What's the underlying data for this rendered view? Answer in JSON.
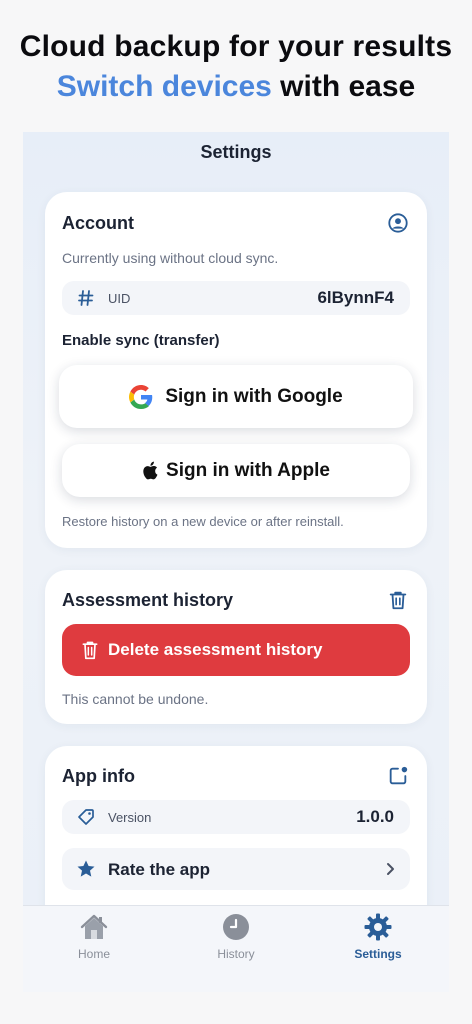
{
  "promo": {
    "line1": "Cloud backup for your results",
    "line2_accent": "Switch devices",
    "line2_rest": " with ease"
  },
  "screen": {
    "title": "Settings"
  },
  "account": {
    "title": "Account",
    "icon": "user-circle-icon",
    "status": "Currently using without cloud sync.",
    "uid_label": "UID",
    "uid_value": "6lBynnF4",
    "sync_heading": "Enable sync (transfer)",
    "google_button": "Sign in with Google",
    "apple_button": "Sign in with Apple",
    "note": "Restore history on a new device or after reinstall."
  },
  "history": {
    "title": "Assessment history",
    "icon": "trash-icon",
    "delete_button": "Delete assessment history",
    "note": "This cannot be undone."
  },
  "app_info": {
    "title": "App info",
    "icon": "notification-square-icon",
    "version_label": "Version",
    "version_value": "1.0.0",
    "rate_label": "Rate the app"
  },
  "tabs": [
    {
      "label": "Home",
      "icon": "home-icon",
      "active": false
    },
    {
      "label": "History",
      "icon": "clock-icon",
      "active": false
    },
    {
      "label": "Settings",
      "icon": "gear-icon",
      "active": true
    }
  ],
  "colors": {
    "accent": "#4b86dc",
    "danger": "#df3b3f",
    "active_tab": "#2a5d97",
    "icon_blue": "#2a5d97"
  }
}
